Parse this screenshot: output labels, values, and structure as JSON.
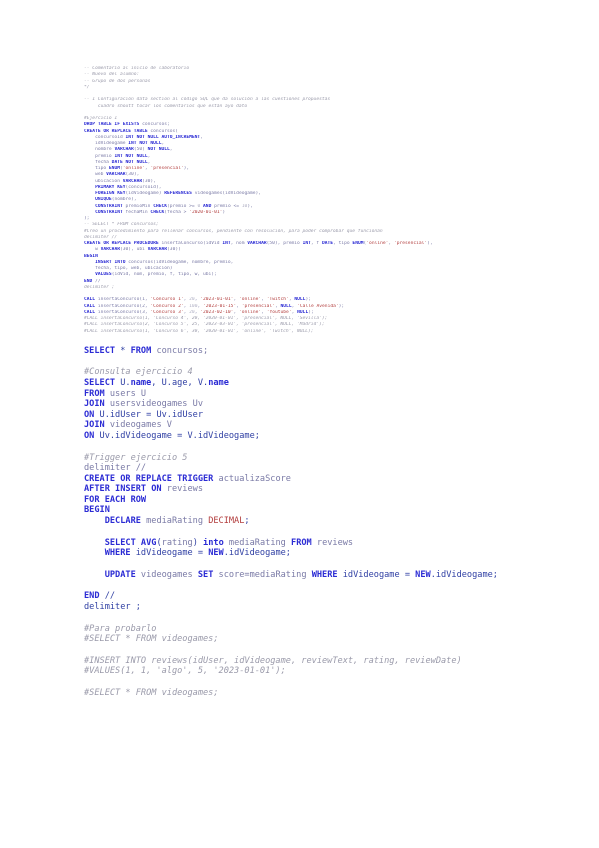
{
  "sections": [
    {
      "size": "sm",
      "tokens": [
        [
          "c",
          "-- Comentario al inicio de laboratorio"
        ]
      ]
    },
    {
      "size": "sm",
      "tokens": [
        [
          "c",
          "-- Nuevo del alumno:"
        ]
      ]
    },
    {
      "size": "sm",
      "tokens": [
        [
          "c",
          "-- Grupo de dos personas"
        ]
      ]
    },
    {
      "size": "sm",
      "tokens": [
        [
          "c",
          "*/"
        ]
      ]
    },
    {
      "size": "sm",
      "tokens": []
    },
    {
      "size": "sm",
      "tokens": [
        [
          "c",
          "-- 1 Configuración data section al código SQL que da solución a las cuestiones propuestas"
        ]
      ]
    },
    {
      "size": "sm",
      "tokens": [
        [
          "c",
          "     cuadro shoutt tocar los comentarios que están ayo dato"
        ]
      ]
    },
    {
      "size": "sm",
      "tokens": []
    },
    {
      "size": "sm",
      "tokens": [
        [
          "c",
          "#Ejercicio 1"
        ]
      ]
    },
    {
      "size": "sm",
      "tokens": [
        [
          "k",
          "DROP TABLE IF EXISTS"
        ],
        [
          "t",
          " concursos;"
        ]
      ]
    },
    {
      "size": "sm",
      "tokens": [
        [
          "k",
          "CREATE OR REPLACE TABLE"
        ],
        [
          "t",
          " concursos("
        ]
      ]
    },
    {
      "size": "sm",
      "tokens": [
        [
          "t",
          "    concursoId "
        ],
        [
          "k",
          "INT NOT NULL AUTO_INCREMENT"
        ],
        [
          "t",
          ","
        ]
      ]
    },
    {
      "size": "sm",
      "tokens": [
        [
          "t",
          "    idVideogame "
        ],
        [
          "k",
          "INT NOT NULL"
        ],
        [
          "t",
          ","
        ]
      ]
    },
    {
      "size": "sm",
      "tokens": [
        [
          "t",
          "    nombre "
        ],
        [
          "k",
          "VARCHAR"
        ],
        [
          "t",
          "(50) "
        ],
        [
          "k",
          "NOT NULL"
        ],
        [
          "t",
          ","
        ]
      ]
    },
    {
      "size": "sm",
      "tokens": [
        [
          "t",
          "    premio "
        ],
        [
          "k",
          "INT NOT NULL"
        ],
        [
          "t",
          ","
        ]
      ]
    },
    {
      "size": "sm",
      "tokens": [
        [
          "t",
          "    fecha "
        ],
        [
          "k",
          "DATE NOT NULL"
        ],
        [
          "t",
          ","
        ]
      ]
    },
    {
      "size": "sm",
      "tokens": [
        [
          "t",
          "    tipo "
        ],
        [
          "k",
          "ENUM"
        ],
        [
          "t",
          "("
        ],
        [
          "s",
          "'online'"
        ],
        [
          "t",
          ", "
        ],
        [
          "s",
          "'presencial'"
        ],
        [
          "t",
          "),"
        ]
      ]
    },
    {
      "size": "sm",
      "tokens": [
        [
          "t",
          "    web "
        ],
        [
          "k",
          "VARCHAR"
        ],
        [
          "t",
          "(30),"
        ]
      ]
    },
    {
      "size": "sm",
      "tokens": [
        [
          "t",
          "    ubicacion "
        ],
        [
          "k",
          "VARCHAR"
        ],
        [
          "t",
          "(30),"
        ]
      ]
    },
    {
      "size": "sm",
      "tokens": [
        [
          "t",
          "    "
        ],
        [
          "k",
          "PRIMARY KEY"
        ],
        [
          "t",
          "(concursoId),"
        ]
      ]
    },
    {
      "size": "sm",
      "tokens": [
        [
          "t",
          "    "
        ],
        [
          "k",
          "FOREIGN KEY"
        ],
        [
          "t",
          "(idVideogame) "
        ],
        [
          "k",
          "REFERENCES"
        ],
        [
          "t",
          " videogames(idVideogame),"
        ]
      ]
    },
    {
      "size": "sm",
      "tokens": [
        [
          "t",
          "    "
        ],
        [
          "k",
          "UNIQUE"
        ],
        [
          "t",
          "(nombre),"
        ]
      ]
    },
    {
      "size": "sm",
      "tokens": [
        [
          "t",
          "    "
        ],
        [
          "k",
          "CONSTRAINT"
        ],
        [
          "t",
          " premioMin "
        ],
        [
          "k",
          "CHECK"
        ],
        [
          "t",
          "(premio >= "
        ],
        [
          "n",
          "0"
        ],
        [
          "t",
          " "
        ],
        [
          "k",
          "AND"
        ],
        [
          "t",
          " premio <= "
        ],
        [
          "n",
          "10"
        ],
        [
          "t",
          "),"
        ]
      ]
    },
    {
      "size": "sm",
      "tokens": [
        [
          "t",
          "    "
        ],
        [
          "k",
          "CONSTRAINT"
        ],
        [
          "t",
          " fechaMin "
        ],
        [
          "k",
          "CHECK"
        ],
        [
          "t",
          "(fecha > "
        ],
        [
          "s",
          "'2020-01-01'"
        ],
        [
          "t",
          ")"
        ]
      ]
    },
    {
      "size": "sm",
      "tokens": [
        [
          "t",
          ");"
        ]
      ]
    },
    {
      "size": "sm",
      "tokens": [
        [
          "c",
          "-- SELECT * FROM concursos;"
        ]
      ]
    },
    {
      "size": "sm",
      "tokens": [
        [
          "c",
          "#Creo un procedimiento para rellenar concursos, pendiente con resolución, para poder comprobar que funcionan"
        ]
      ]
    },
    {
      "size": "sm",
      "tokens": [
        [
          "c",
          "delimiter //"
        ]
      ]
    },
    {
      "size": "sm",
      "tokens": [
        [
          "k",
          "CREATE OR REPLACE PROCEDURE"
        ],
        [
          "t",
          " insertaConcurso(idVid "
        ],
        [
          "k",
          "INT"
        ],
        [
          "t",
          ", nom "
        ],
        [
          "k",
          "VARCHAR"
        ],
        [
          "t",
          "(50), premio "
        ],
        [
          "k",
          "INT"
        ],
        [
          "t",
          ", f "
        ],
        [
          "k",
          "DATE"
        ],
        [
          "t",
          ", tipo "
        ],
        [
          "k",
          "ENUM"
        ],
        [
          "t",
          "("
        ],
        [
          "s",
          "'online'"
        ],
        [
          "t",
          ", "
        ],
        [
          "s",
          "'presencial'"
        ],
        [
          "t",
          "),"
        ]
      ]
    },
    {
      "size": "sm",
      "tokens": [
        [
          "t",
          "    w "
        ],
        [
          "k",
          "VARCHAR"
        ],
        [
          "t",
          "(30), ubi "
        ],
        [
          "k",
          "VARCHAR"
        ],
        [
          "t",
          "(30))"
        ]
      ]
    },
    {
      "size": "sm",
      "tokens": [
        [
          "k",
          "BEGIN"
        ]
      ]
    },
    {
      "size": "sm",
      "tokens": [
        [
          "t",
          "    "
        ],
        [
          "k",
          "INSERT INTO"
        ],
        [
          "t",
          " concursos(idVideogame, nombre, premio,"
        ]
      ]
    },
    {
      "size": "sm",
      "tokens": [
        [
          "t",
          "    fecha, tipo, web, ubicacion)"
        ]
      ]
    },
    {
      "size": "sm",
      "tokens": [
        [
          "t",
          "    "
        ],
        [
          "k",
          "VALUES"
        ],
        [
          "t",
          "(idVid, nom, premio, f, tipo, w, ubi);"
        ]
      ]
    },
    {
      "size": "sm",
      "tokens": [
        [
          "k",
          "END"
        ],
        [
          "t",
          " //"
        ]
      ]
    },
    {
      "size": "sm",
      "tokens": [
        [
          "c",
          "delimiter ;"
        ]
      ]
    },
    {
      "size": "sm",
      "tokens": []
    },
    {
      "size": "sm",
      "tokens": [
        [
          "k",
          "CALL"
        ],
        [
          "t",
          " insertaConcurso(1, "
        ],
        [
          "s",
          "'Concurso 1'"
        ],
        [
          "t",
          ", "
        ],
        [
          "n",
          "20"
        ],
        [
          "t",
          ", "
        ],
        [
          "s",
          "'2023-01-01'"
        ],
        [
          "t",
          ", "
        ],
        [
          "s",
          "'online'"
        ],
        [
          "t",
          ", "
        ],
        [
          "s",
          "'Twitch'"
        ],
        [
          "t",
          ", "
        ],
        [
          "k",
          "NULL"
        ],
        [
          "t",
          ");"
        ]
      ]
    },
    {
      "size": "sm",
      "tokens": [
        [
          "k",
          "CALL"
        ],
        [
          "t",
          " insertaConcurso(2, "
        ],
        [
          "s",
          "'Concurso 2'"
        ],
        [
          "t",
          ", "
        ],
        [
          "n",
          "100"
        ],
        [
          "t",
          ", "
        ],
        [
          "s",
          "'2023-01-15'"
        ],
        [
          "t",
          ", "
        ],
        [
          "s",
          "'presencial'"
        ],
        [
          "t",
          ", "
        ],
        [
          "k",
          "NULL"
        ],
        [
          "t",
          ", "
        ],
        [
          "s",
          "'Calle Avenida'"
        ],
        [
          "t",
          ");"
        ]
      ]
    },
    {
      "size": "sm",
      "tokens": [
        [
          "k",
          "CALL"
        ],
        [
          "t",
          " insertaConcurso(3, "
        ],
        [
          "s",
          "'Concurso 3'"
        ],
        [
          "t",
          ", "
        ],
        [
          "n",
          "20"
        ],
        [
          "t",
          ", "
        ],
        [
          "s",
          "'2023-02-10'"
        ],
        [
          "t",
          ", "
        ],
        [
          "s",
          "'online'"
        ],
        [
          "t",
          ", "
        ],
        [
          "s",
          "'Youtube'"
        ],
        [
          "t",
          ", "
        ],
        [
          "k",
          "NULL"
        ],
        [
          "t",
          ");"
        ]
      ]
    },
    {
      "size": "sm",
      "tokens": [
        [
          "c",
          "#CALL insertaConcurso(1, 'Concurso 4', 20, '2020-01-01', 'presencial', NULL, 'Sevilla');"
        ]
      ]
    },
    {
      "size": "sm",
      "tokens": [
        [
          "c",
          "#CALL insertaConcurso(2, 'Concurso 5', 25, '2023-03-01', 'presencial', NULL, 'Madrid');"
        ]
      ]
    },
    {
      "size": "sm",
      "tokens": [
        [
          "c",
          "#CALL insertaConcurso(1, 'Concurso 6', 30, '2020-01-01', 'online', 'Twitch', NULL);"
        ]
      ]
    },
    {
      "size": "lg",
      "tokens": []
    },
    {
      "size": "lg",
      "tokens": [
        [
          "k",
          "SELECT"
        ],
        [
          "p",
          " * "
        ],
        [
          "k",
          "FROM"
        ],
        [
          "t",
          " concursos;"
        ]
      ]
    },
    {
      "size": "lg",
      "tokens": []
    },
    {
      "size": "lg",
      "tokens": [
        [
          "c",
          "#Consulta ejercicio 4"
        ]
      ]
    },
    {
      "size": "lg",
      "tokens": [
        [
          "k",
          "SELECT"
        ],
        [
          "p",
          " U."
        ],
        [
          "k",
          "name"
        ],
        [
          "p",
          ", U.age, V."
        ],
        [
          "k",
          "name"
        ]
      ]
    },
    {
      "size": "lg",
      "tokens": [
        [
          "k",
          "FROM"
        ],
        [
          "t",
          " users U"
        ]
      ]
    },
    {
      "size": "lg",
      "tokens": [
        [
          "k",
          "JOIN"
        ],
        [
          "t",
          " usersvideogames Uv"
        ]
      ]
    },
    {
      "size": "lg",
      "tokens": [
        [
          "k",
          "ON"
        ],
        [
          "p",
          " U.idUser = Uv.idUser"
        ]
      ]
    },
    {
      "size": "lg",
      "tokens": [
        [
          "k",
          "JOIN"
        ],
        [
          "t",
          " videogames V"
        ]
      ]
    },
    {
      "size": "lg",
      "tokens": [
        [
          "k",
          "ON"
        ],
        [
          "p",
          " Uv.idVideogame = V.idVideogame;"
        ]
      ]
    },
    {
      "size": "lg",
      "tokens": []
    },
    {
      "size": "lg",
      "tokens": [
        [
          "c",
          "#Trigger ejercicio 5"
        ]
      ]
    },
    {
      "size": "lg",
      "tokens": [
        [
          "t",
          "delimiter //"
        ]
      ]
    },
    {
      "size": "lg",
      "tokens": [
        [
          "k",
          "CREATE OR REPLACE TRIGGER"
        ],
        [
          "t",
          " actualizaScore"
        ]
      ]
    },
    {
      "size": "lg",
      "tokens": [
        [
          "k",
          "AFTER INSERT ON"
        ],
        [
          "t",
          " reviews"
        ]
      ]
    },
    {
      "size": "lg",
      "tokens": [
        [
          "k",
          "FOR EACH ROW"
        ]
      ]
    },
    {
      "size": "lg",
      "tokens": [
        [
          "k",
          "BEGIN"
        ]
      ]
    },
    {
      "size": "lg",
      "tokens": [
        [
          "t",
          "    "
        ],
        [
          "k",
          "DECLARE"
        ],
        [
          "t",
          " mediaRating "
        ],
        [
          "s",
          "DECIMAL"
        ],
        [
          "p",
          ";"
        ]
      ]
    },
    {
      "size": "lg",
      "tokens": []
    },
    {
      "size": "lg",
      "tokens": [
        [
          "t",
          "    "
        ],
        [
          "k",
          "SELECT AVG"
        ],
        [
          "p",
          "("
        ],
        [
          "t",
          "rating"
        ],
        [
          "p",
          ") "
        ],
        [
          "k",
          "into"
        ],
        [
          "t",
          " mediaRating "
        ],
        [
          "k",
          "FROM"
        ],
        [
          "t",
          " reviews"
        ]
      ]
    },
    {
      "size": "lg",
      "tokens": [
        [
          "t",
          "    "
        ],
        [
          "k",
          "WHERE"
        ],
        [
          "p",
          " idVideogame = "
        ],
        [
          "k",
          "NEW"
        ],
        [
          "p",
          ".idVideogame;"
        ]
      ]
    },
    {
      "size": "lg",
      "tokens": []
    },
    {
      "size": "lg",
      "tokens": [
        [
          "t",
          "    "
        ],
        [
          "k",
          "UPDATE"
        ],
        [
          "t",
          " videogames "
        ],
        [
          "k",
          "SET"
        ],
        [
          "t",
          " score=mediaRating "
        ],
        [
          "k",
          "WHERE"
        ],
        [
          "p",
          " idVideogame = "
        ],
        [
          "k",
          "NEW"
        ],
        [
          "p",
          ".idVideogame;"
        ]
      ]
    },
    {
      "size": "lg",
      "tokens": []
    },
    {
      "size": "lg",
      "tokens": [
        [
          "k",
          "END"
        ],
        [
          "p",
          " //"
        ]
      ]
    },
    {
      "size": "lg",
      "tokens": [
        [
          "p",
          "delimiter ;"
        ]
      ]
    },
    {
      "size": "lg",
      "tokens": []
    },
    {
      "size": "lg",
      "tokens": [
        [
          "c",
          "#Para probarlo"
        ]
      ]
    },
    {
      "size": "lg",
      "tokens": [
        [
          "c",
          "#SELECT * FROM videogames;"
        ]
      ]
    },
    {
      "size": "lg",
      "tokens": []
    },
    {
      "size": "lg",
      "tokens": [
        [
          "c",
          "#INSERT INTO reviews(idUser, idVideogame, reviewText, rating, reviewDate)"
        ]
      ]
    },
    {
      "size": "lg",
      "tokens": [
        [
          "c",
          "#VALUES(1, 1, 'algo', 5, '2023-01-01');"
        ]
      ]
    },
    {
      "size": "lg",
      "tokens": []
    },
    {
      "size": "lg",
      "tokens": [
        [
          "c",
          "#SELECT * FROM videogames;"
        ]
      ]
    }
  ]
}
